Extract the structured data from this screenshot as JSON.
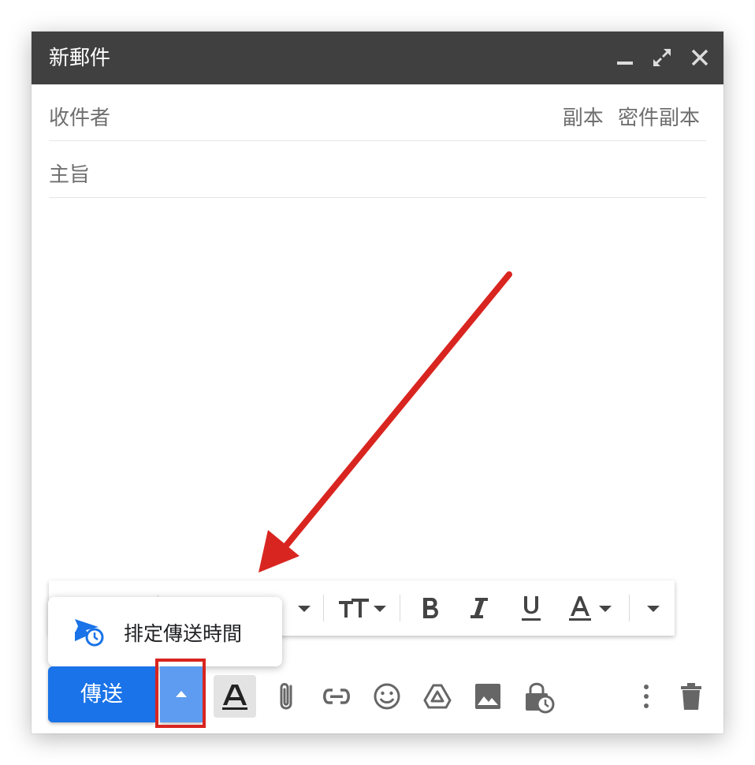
{
  "window": {
    "title": "新郵件"
  },
  "fields": {
    "to_label": "收件者",
    "cc_label": "副本",
    "bcc_label": "密件副本",
    "subject_label": "主旨"
  },
  "schedule_popup": {
    "label": "排定傳送時間"
  },
  "send": {
    "label": "傳送"
  },
  "colors": {
    "titlebar": "#404040",
    "send_button": "#1a73e8",
    "send_more": "#5d9cf0",
    "annotation": "#d92520"
  },
  "icons": {
    "window": [
      "minimize-icon",
      "expand-icon",
      "close-icon"
    ],
    "formatting": [
      "font-size-icon",
      "bold-icon",
      "italic-icon",
      "underline-icon",
      "text-color-icon",
      "more-formatting-icon"
    ],
    "bottom_toolbar": [
      "formatting-toggle-icon",
      "attach-icon",
      "link-icon",
      "emoji-icon",
      "drive-icon",
      "photo-icon",
      "confidential-mode-icon",
      "more-options-icon",
      "trash-icon"
    ]
  }
}
